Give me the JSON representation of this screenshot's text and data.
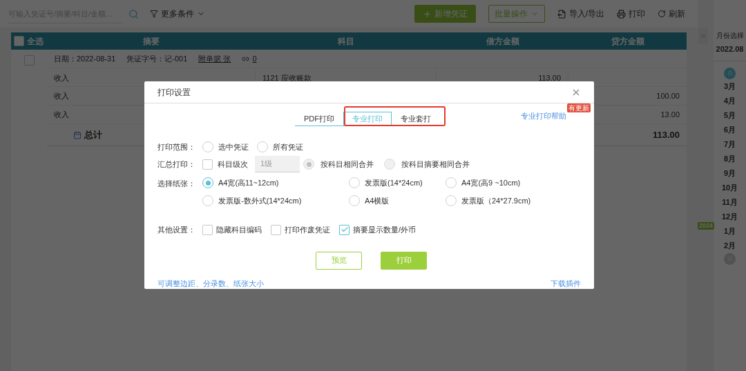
{
  "toolbar": {
    "search": {
      "placeholder": "可输入凭证号/摘要/科目/金额..."
    },
    "filter": "更多条件",
    "buttons": [
      {
        "kind": "primary",
        "label": "新增凭证"
      },
      {
        "kind": "outline",
        "label": "批量操作"
      },
      {
        "kind": "import",
        "label": "导入/导出"
      },
      {
        "kind": "print",
        "label": "打印"
      },
      {
        "kind": "refresh",
        "label": "刷新"
      }
    ]
  },
  "table": {
    "select_all": {
      "label": "全选",
      "checked": false
    },
    "columns": [
      "摘要",
      "科目",
      "借方金额",
      "贷方金额"
    ],
    "voucher": {
      "checked": false,
      "date": "日期：2022-08-31",
      "number": "凭证字号：记-001",
      "attachments": "附单据 张",
      "link_count": "0"
    },
    "entries": [
      {
        "summary": "收入",
        "account": "1121 应收账款",
        "debit": "113.00"
      },
      {
        "summary": "收入",
        "credit": "100.00"
      },
      {
        "summary": "收入",
        "credit": "13.00"
      }
    ],
    "total": {
      "label": "总计",
      "credit": "113.00"
    }
  },
  "month_panel": {
    "title": "月份选择",
    "value": "2022.08",
    "year_badge": "2024",
    "months": [
      {
        "label": "3月"
      },
      {
        "label": "4月"
      },
      {
        "label": "5月"
      },
      {
        "label": "6月"
      },
      {
        "label": "7月"
      },
      {
        "label": "8月"
      },
      {
        "label": "9月"
      },
      {
        "label": "10月"
      },
      {
        "label": "11月"
      },
      {
        "label": "12月"
      },
      {
        "label": "1月"
      },
      {
        "label": "2月"
      }
    ]
  },
  "dialog": {
    "title": "打印设置",
    "tabs": [
      {
        "label": "PDF打印",
        "selected": false
      },
      {
        "label": "专业打印",
        "selected": true
      },
      {
        "label": "专业套打",
        "selected": false
      }
    ],
    "help_link": "专业打印帮助",
    "help_badge": "有更新",
    "print_range": {
      "label": "打印范围：",
      "options": [
        {
          "label": "选中凭证",
          "selected": false
        },
        {
          "label": "所有凭证",
          "selected": false
        }
      ]
    },
    "summary_print": {
      "label": "汇总打印：",
      "checkbox": {
        "label": "科目级次",
        "checked": false
      },
      "level_field": {
        "value": "1级",
        "disabled": true
      },
      "options": [
        {
          "label": "按科目相同合并",
          "selected": true,
          "disabled": true
        },
        {
          "label": "按科目摘要相同合并",
          "selected": false,
          "disabled": true
        }
      ]
    },
    "paper": {
      "label": "选择纸张：",
      "options": [
        {
          "label": "A4宽(高11~12cm)",
          "selected": true
        },
        {
          "label": "发票版(14*24cm)",
          "selected": false
        },
        {
          "label": "A4宽(高9 ~10cm)",
          "selected": false
        },
        {
          "label": "发票版-数外式(14*24cm)",
          "selected": false
        },
        {
          "label": "A4横版",
          "selected": false
        },
        {
          "label": "发票版（24*27.9cm)",
          "selected": false
        }
      ]
    },
    "other": {
      "label": "其他设置：",
      "options": [
        {
          "label": "隐藏科目编码",
          "checked": false
        },
        {
          "label": "打印作废凭证",
          "checked": false
        },
        {
          "label": "摘要显示数量/外币",
          "checked": true
        }
      ]
    },
    "preview_button": "预览",
    "print_button": "打印",
    "footer_link": "可调整边距、分录数、纸张大小",
    "download_link": "下载插件"
  }
}
